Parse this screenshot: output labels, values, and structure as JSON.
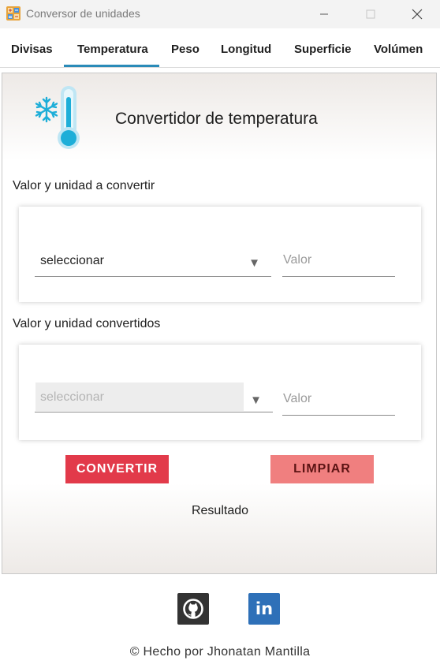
{
  "window": {
    "title": "Conversor de unidades",
    "icon": "calculator-icon"
  },
  "tabs": [
    {
      "label": "Divisas"
    },
    {
      "label": "Temperatura",
      "active": true
    },
    {
      "label": "Peso"
    },
    {
      "label": "Longitud"
    },
    {
      "label": "Superficie"
    },
    {
      "label": "Volúmen"
    }
  ],
  "header": {
    "title": "Convertidor de temperatura",
    "icon": "thermometer-snowflake-icon"
  },
  "input_section": {
    "label": "Valor y unidad a convertir",
    "select_value": "seleccionar",
    "value_placeholder": "Valor"
  },
  "output_section": {
    "label": "Valor y unidad convertidos",
    "select_value": "seleccionar",
    "value_placeholder": "Valor",
    "disabled": true
  },
  "buttons": {
    "convert": "CONVERTIR",
    "clear": "LIMPIAR"
  },
  "result_label": "Resultado",
  "footer": {
    "credit": "© Hecho por Jhonatan Mantilla",
    "links": [
      {
        "icon": "github-icon"
      },
      {
        "icon": "linkedin-icon",
        "text": "in"
      }
    ]
  },
  "colors": {
    "accent": "#2a8bb8",
    "convert_button": "#e23a4a",
    "clear_button": "#f07f7f",
    "github": "#333333",
    "linkedin": "#2e70b8"
  }
}
